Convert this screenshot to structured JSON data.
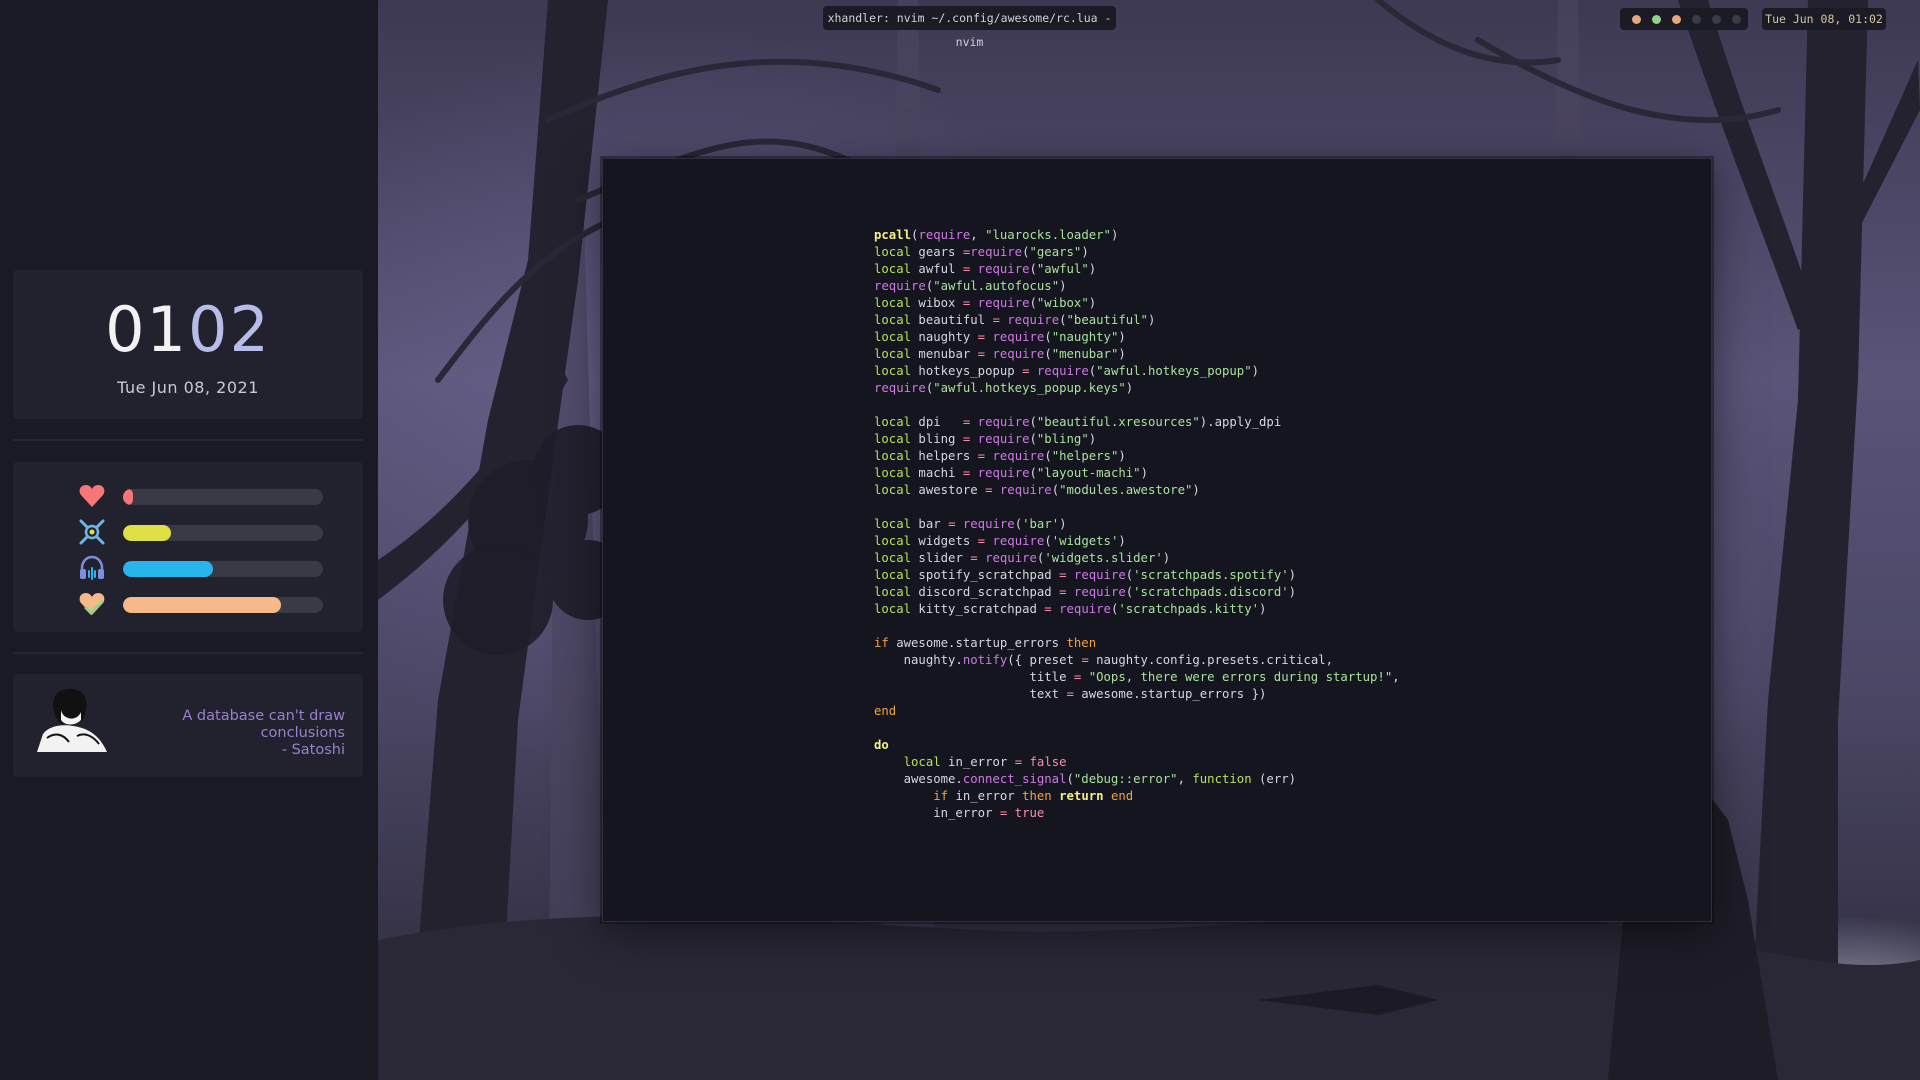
{
  "topbar": {
    "window_title": "xhandler: nvim ~/.config/awesome/rc.lua - nvim",
    "clock": "Tue Jun 08, 01:02",
    "tray_icon_colors": [
      "#e9a87c",
      "#8fd48a",
      "#e9a87c",
      "#3a3a48",
      "#3a3a48",
      "#3a3a48"
    ]
  },
  "sidebar": {
    "clock": {
      "hour": "01",
      "minute": "02",
      "date": "Tue Jun 08, 2021"
    },
    "stats": [
      {
        "name": "health",
        "icon": "heart-icon",
        "color": "#f87677",
        "fill": 0.05
      },
      {
        "name": "cpu",
        "icon": "cpu-icon",
        "color": "#dfe045",
        "fill": 0.24
      },
      {
        "name": "volume",
        "icon": "headphones-icon",
        "color": "#27b5ec",
        "fill": 0.45
      },
      {
        "name": "memory",
        "icon": "heart-check-icon",
        "color": "#f5ba88",
        "fill": 0.79
      }
    ],
    "quote": {
      "line1": "A database can't draw conclusions",
      "line2": "- Satoshi"
    }
  },
  "editor": {
    "lines": [
      [
        [
          "bf",
          "pcall"
        ],
        [
          "",
          "("
        ],
        [
          "fn",
          "require"
        ],
        [
          "",
          ", "
        ],
        [
          "st",
          "\"luarocks.loader\""
        ],
        [
          "",
          ")"
        ]
      ],
      [
        [
          "kw",
          "local"
        ],
        [
          "",
          " gears "
        ],
        [
          "op",
          "="
        ],
        [
          "",
          "",
          " "
        ],
        [
          "fn",
          "require"
        ],
        [
          "",
          "("
        ],
        [
          "st",
          "\"gears\""
        ],
        [
          "",
          ")"
        ]
      ],
      [
        [
          "kw",
          "local"
        ],
        [
          "",
          " awful "
        ],
        [
          "op",
          "="
        ],
        [
          "",
          " "
        ],
        [
          "fn",
          "require"
        ],
        [
          "",
          "("
        ],
        [
          "st",
          "\"awful\""
        ],
        [
          "",
          ")"
        ]
      ],
      [
        [
          "fn",
          "require"
        ],
        [
          "",
          "("
        ],
        [
          "st",
          "\"awful.autofocus\""
        ],
        [
          "",
          ")"
        ]
      ],
      [
        [
          "kw",
          "local"
        ],
        [
          "",
          " wibox "
        ],
        [
          "op",
          "="
        ],
        [
          "",
          " "
        ],
        [
          "fn",
          "require"
        ],
        [
          "",
          "("
        ],
        [
          "st",
          "\"wibox\""
        ],
        [
          "",
          ")"
        ]
      ],
      [
        [
          "kw",
          "local"
        ],
        [
          "",
          " beautiful "
        ],
        [
          "op",
          "="
        ],
        [
          "",
          " "
        ],
        [
          "fn",
          "require"
        ],
        [
          "",
          "("
        ],
        [
          "st",
          "\"beautiful\""
        ],
        [
          "",
          ")"
        ]
      ],
      [
        [
          "kw",
          "local"
        ],
        [
          "",
          " naughty "
        ],
        [
          "op",
          "="
        ],
        [
          "",
          " "
        ],
        [
          "fn",
          "require"
        ],
        [
          "",
          "("
        ],
        [
          "st",
          "\"naughty\""
        ],
        [
          "",
          ")"
        ]
      ],
      [
        [
          "kw",
          "local"
        ],
        [
          "",
          " menubar "
        ],
        [
          "op",
          "="
        ],
        [
          "",
          " "
        ],
        [
          "fn",
          "require"
        ],
        [
          "",
          "("
        ],
        [
          "st",
          "\"menubar\""
        ],
        [
          "",
          ")"
        ]
      ],
      [
        [
          "kw",
          "local"
        ],
        [
          "",
          " hotkeys_popup "
        ],
        [
          "op",
          "="
        ],
        [
          "",
          " "
        ],
        [
          "fn",
          "require"
        ],
        [
          "",
          "("
        ],
        [
          "st",
          "\"awful.hotkeys_popup\""
        ],
        [
          "",
          ")"
        ]
      ],
      [
        [
          "fn",
          "require"
        ],
        [
          "",
          "("
        ],
        [
          "st",
          "\"awful.hotkeys_popup.keys\""
        ],
        [
          "",
          ")"
        ]
      ],
      [],
      [
        [
          "kw",
          "local"
        ],
        [
          "",
          " dpi   "
        ],
        [
          "op",
          "="
        ],
        [
          "",
          " "
        ],
        [
          "fn",
          "require"
        ],
        [
          "",
          "("
        ],
        [
          "st",
          "\"beautiful.xresources\""
        ],
        [
          "",
          ").apply_dpi"
        ]
      ],
      [
        [
          "kw",
          "local"
        ],
        [
          "",
          " bling "
        ],
        [
          "op",
          "="
        ],
        [
          "",
          " "
        ],
        [
          "fn",
          "require"
        ],
        [
          "",
          "("
        ],
        [
          "st",
          "\"bling\""
        ],
        [
          "",
          ")"
        ]
      ],
      [
        [
          "kw",
          "local"
        ],
        [
          "",
          " helpers "
        ],
        [
          "op",
          "="
        ],
        [
          "",
          " "
        ],
        [
          "fn",
          "require"
        ],
        [
          "",
          "("
        ],
        [
          "st",
          "\"helpers\""
        ],
        [
          "",
          ")"
        ]
      ],
      [
        [
          "kw",
          "local"
        ],
        [
          "",
          " machi "
        ],
        [
          "op",
          "="
        ],
        [
          "",
          " "
        ],
        [
          "fn",
          "require"
        ],
        [
          "",
          "("
        ],
        [
          "st",
          "\"layout-machi\""
        ],
        [
          "",
          ")"
        ]
      ],
      [
        [
          "kw",
          "local"
        ],
        [
          "",
          " awestore "
        ],
        [
          "op",
          "="
        ],
        [
          "",
          " "
        ],
        [
          "fn",
          "require"
        ],
        [
          "",
          "("
        ],
        [
          "st",
          "\"modules.awestore\""
        ],
        [
          "",
          ")"
        ]
      ],
      [],
      [
        [
          "kw",
          "local"
        ],
        [
          "",
          " bar "
        ],
        [
          "op",
          "="
        ],
        [
          "",
          " "
        ],
        [
          "fn",
          "require"
        ],
        [
          "",
          "("
        ],
        [
          "st",
          "'bar'"
        ],
        [
          "",
          ")"
        ]
      ],
      [
        [
          "kw",
          "local"
        ],
        [
          "",
          " widgets "
        ],
        [
          "op",
          "="
        ],
        [
          "",
          " "
        ],
        [
          "fn",
          "require"
        ],
        [
          "",
          "("
        ],
        [
          "st",
          "'widgets'"
        ],
        [
          "",
          ")"
        ]
      ],
      [
        [
          "kw",
          "local"
        ],
        [
          "",
          " slider "
        ],
        [
          "op",
          "="
        ],
        [
          "",
          " "
        ],
        [
          "fn",
          "require"
        ],
        [
          "",
          "("
        ],
        [
          "st",
          "'widgets.slider'"
        ],
        [
          "",
          ")"
        ]
      ],
      [
        [
          "kw",
          "local"
        ],
        [
          "",
          " spotify_scratchpad "
        ],
        [
          "op",
          "="
        ],
        [
          "",
          " "
        ],
        [
          "fn",
          "require"
        ],
        [
          "",
          "("
        ],
        [
          "st",
          "'scratchpads.spotify'"
        ],
        [
          "",
          ")"
        ]
      ],
      [
        [
          "kw",
          "local"
        ],
        [
          "",
          " discord_scratchpad "
        ],
        [
          "op",
          "="
        ],
        [
          "",
          " "
        ],
        [
          "fn",
          "require"
        ],
        [
          "",
          "("
        ],
        [
          "st",
          "'scratchpads.discord'"
        ],
        [
          "",
          ")"
        ]
      ],
      [
        [
          "kw",
          "local"
        ],
        [
          "",
          " kitty_scratchpad "
        ],
        [
          "op",
          "="
        ],
        [
          "",
          " "
        ],
        [
          "fn",
          "require"
        ],
        [
          "",
          "("
        ],
        [
          "st",
          "'scratchpads.kitty'"
        ],
        [
          "",
          ")"
        ]
      ],
      [],
      [
        [
          "ctrl",
          "if"
        ],
        [
          "",
          " awesome.startup_errors "
        ],
        [
          "ctrl",
          "then"
        ]
      ],
      [
        [
          "",
          "    naughty."
        ],
        [
          "fn",
          "notify"
        ],
        [
          "",
          "({ preset "
        ],
        [
          "op",
          "="
        ],
        [
          "",
          " naughty.config.presets.critical,"
        ]
      ],
      [
        [
          "",
          "                     title "
        ],
        [
          "op",
          "="
        ],
        [
          "",
          " "
        ],
        [
          "st",
          "\"Oops, there were errors during startup!\""
        ],
        [
          "",
          ","
        ]
      ],
      [
        [
          "",
          "                     text "
        ],
        [
          "op",
          "="
        ],
        [
          "",
          " awesome.startup_errors })"
        ]
      ],
      [
        [
          "ctrl",
          "end"
        ]
      ],
      [],
      [
        [
          "bf",
          "do"
        ]
      ],
      [
        [
          "",
          "    "
        ],
        [
          "kw",
          "local"
        ],
        [
          "",
          " in_error "
        ],
        [
          "op",
          "="
        ],
        [
          "",
          " "
        ],
        [
          "op",
          "false"
        ]
      ],
      [
        [
          "",
          "    awesome."
        ],
        [
          "fn",
          "connect_signal"
        ],
        [
          "",
          "("
        ],
        [
          "st",
          "\"debug::error\""
        ],
        [
          "",
          ", "
        ],
        [
          "kw",
          "function"
        ],
        [
          "",
          " (err)"
        ]
      ],
      [
        [
          "",
          "        "
        ],
        [
          "ctrl",
          "if"
        ],
        [
          "",
          " in_error "
        ],
        [
          "ctrl",
          "then"
        ],
        [
          "",
          " "
        ],
        [
          "bf",
          "return"
        ],
        [
          "",
          " "
        ],
        [
          "ctrl",
          "end"
        ]
      ],
      [
        [
          "",
          "        in_error "
        ],
        [
          "op",
          "="
        ],
        [
          "",
          " "
        ],
        [
          "op",
          "true"
        ]
      ]
    ]
  }
}
